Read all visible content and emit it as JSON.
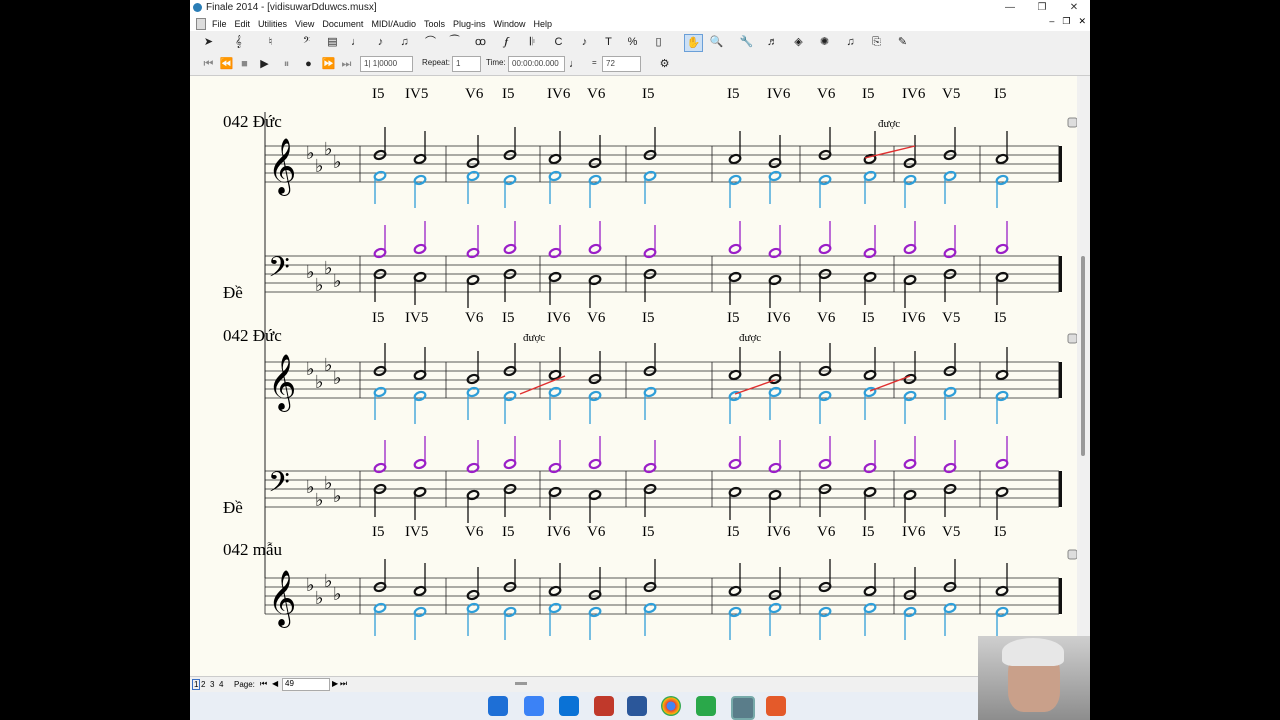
{
  "window": {
    "title": "Finale 2014 - [vidisuwarDduwcs.musx]"
  },
  "menu": [
    "File",
    "Edit",
    "Utilities",
    "View",
    "Document",
    "MIDI/Audio",
    "Tools",
    "Plug-ins",
    "Window",
    "Help"
  ],
  "playback": {
    "measure_counter": "1| 1|0000",
    "repeat_label": "Repeat:",
    "repeat_value": "1",
    "time_label": "Time:",
    "time_value": "00:00:00.000",
    "equals": "=",
    "tempo": "72"
  },
  "status": {
    "pages": [
      "1",
      "2",
      "3",
      "4"
    ],
    "page_label": "Page:",
    "page_value": "49"
  },
  "score": {
    "top_chords": [
      "I5",
      "IV5",
      "V6",
      "I5",
      "IV6",
      "V6",
      "I5",
      "I5",
      "IV6",
      "V6",
      "I5",
      "IV6",
      "V5",
      "I5"
    ],
    "systems": [
      {
        "title": "042 Đức",
        "bass_label": "Đề",
        "annotation": "được",
        "chords": [
          "I5",
          "IV5",
          "V6",
          "I5",
          "IV6",
          "V6",
          "I5",
          "I5",
          "IV6",
          "V6",
          "I5",
          "IV6",
          "V5",
          "I5"
        ]
      },
      {
        "title": "042 Đức",
        "bass_label": "Đề",
        "annotations": [
          "được",
          "được"
        ],
        "chords": [
          "I5",
          "IV5",
          "V6",
          "I5",
          "IV6",
          "V6",
          "I5",
          "I5",
          "IV6",
          "V6",
          "I5",
          "IV6",
          "V5",
          "I5"
        ]
      },
      {
        "title": "042 mẫu"
      }
    ]
  },
  "colors": {
    "blue": "#2f9ed8",
    "purple": "#9a1fc7",
    "red": "#e03030"
  }
}
